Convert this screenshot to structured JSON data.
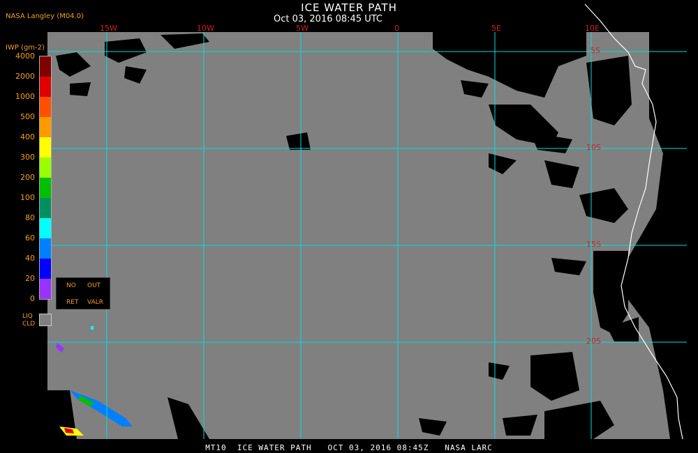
{
  "header": {
    "title": "ICE WATER PATH",
    "subtitle": "Oct 03, 2016 08:45 UTC",
    "source": "NASA Langley (M04.0)"
  },
  "footer": {
    "text": "MT10  ICE WATER PATH   OCT 03, 2016 08:45Z   NASA LARC"
  },
  "grid": {
    "lon_labels": [
      "15W",
      "10W",
      "5W",
      "0",
      "5E",
      "10E"
    ],
    "lat_labels": [
      "5S",
      "10S",
      "15S",
      "20S"
    ]
  },
  "legend": {
    "unit": "IWP (gm-2)",
    "levels": [
      {
        "label": "4000",
        "color": "#800000"
      },
      {
        "label": "2000",
        "color": "#e00000"
      },
      {
        "label": "1000",
        "color": "#ff5000"
      },
      {
        "label": "500",
        "color": "#ff9900"
      },
      {
        "label": "400",
        "color": "#ffff00"
      },
      {
        "label": "300",
        "color": "#99ff00"
      },
      {
        "label": "200",
        "color": "#00c000"
      },
      {
        "label": "100",
        "color": "#009060"
      },
      {
        "label": "80",
        "color": "#00ffff"
      },
      {
        "label": "60",
        "color": "#0080ff"
      },
      {
        "label": "40",
        "color": "#0000ff"
      },
      {
        "label": "20",
        "color": "#9933ff"
      },
      {
        "label": "0",
        "color": ""
      }
    ],
    "no_ret": {
      "line1": "NO",
      "line2": "RET"
    },
    "out_valr": {
      "line1": "OUT",
      "line2": "VALR"
    },
    "liq_cld": {
      "line1": "LIQ",
      "line2": "CLD",
      "color": "#808080"
    }
  },
  "colors": {
    "ocean": "#808080",
    "clear": "#000000",
    "grid": "#00e0e0",
    "coast": "#ffffff",
    "label": "#d02020",
    "accent": "#f0a020"
  }
}
